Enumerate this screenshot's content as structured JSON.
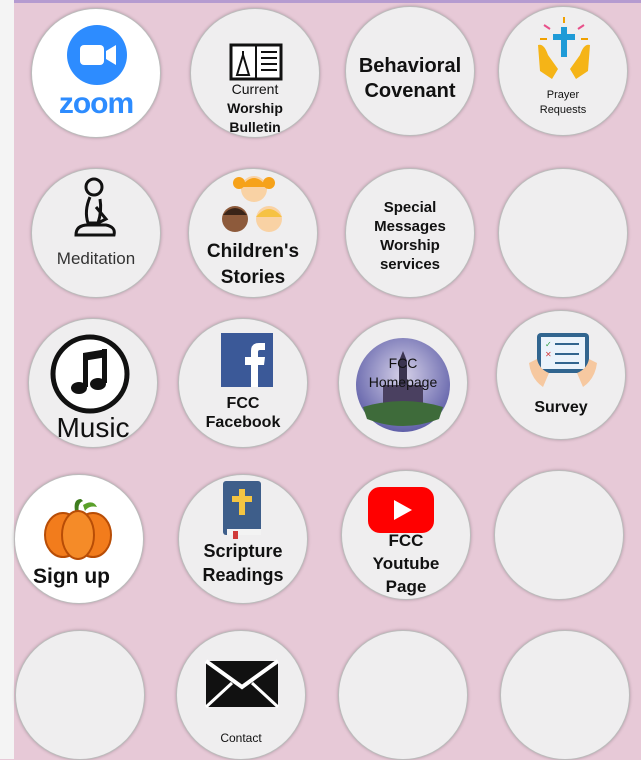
{
  "buttons": {
    "zoom": {
      "label": "zoom"
    },
    "bulletin": {
      "line1": "Current",
      "line2": "Worship",
      "line3": "Bulletin"
    },
    "covenant": {
      "line1": "Behavioral",
      "line2": "Covenant"
    },
    "prayer": {
      "line1": "Prayer",
      "line2": "Requests"
    },
    "meditation": {
      "label": "Meditation"
    },
    "children": {
      "line1": "Children's",
      "line2": "Stories"
    },
    "special": {
      "line1": "Special",
      "line2": "Messages",
      "line3": "Worship",
      "line4": "services"
    },
    "music": {
      "label": "Music"
    },
    "facebook": {
      "line1": "FCC",
      "line2": "Facebook"
    },
    "homepage": {
      "line1": "FCC",
      "line2": "Homepage"
    },
    "survey": {
      "label": "Survey"
    },
    "signup": {
      "label": "Sign up"
    },
    "scripture": {
      "line1": "Scripture",
      "line2": "Readings"
    },
    "youtube": {
      "line1": "FCC",
      "line2": "Youtube",
      "line3": "Page"
    },
    "contact": {
      "label": "Contact"
    }
  },
  "colors": {
    "background": "#e7c9d7",
    "zoom_blue": "#2d8cff",
    "facebook_blue": "#3b5998",
    "youtube_red": "#ff0000",
    "pumpkin_orange": "#f27c1c"
  }
}
